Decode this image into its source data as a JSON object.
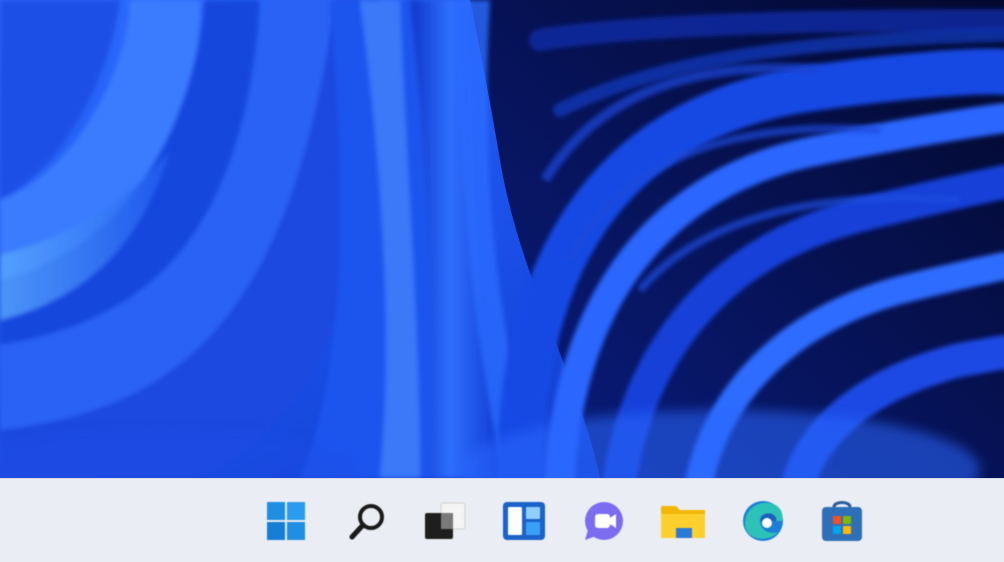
{
  "wallpaper": {
    "name": "bloom-wallpaper",
    "colors": {
      "deep": "#050e3c",
      "dark": "#0b2298",
      "mid": "#1546e0",
      "bright": "#3a7cff",
      "light": "#66b2ff"
    }
  },
  "taskbar": {
    "background": "#ebedf4",
    "items": [
      {
        "name": "start-button",
        "icon": "windows-logo-icon"
      },
      {
        "name": "search-button",
        "icon": "search-icon"
      },
      {
        "name": "task-view-button",
        "icon": "task-view-icon"
      },
      {
        "name": "widgets-button",
        "icon": "widgets-icon"
      },
      {
        "name": "chat-button",
        "icon": "chat-icon"
      },
      {
        "name": "file-explorer-button",
        "icon": "folder-icon"
      },
      {
        "name": "edge-button",
        "icon": "edge-icon"
      },
      {
        "name": "store-button",
        "icon": "store-icon"
      }
    ]
  }
}
